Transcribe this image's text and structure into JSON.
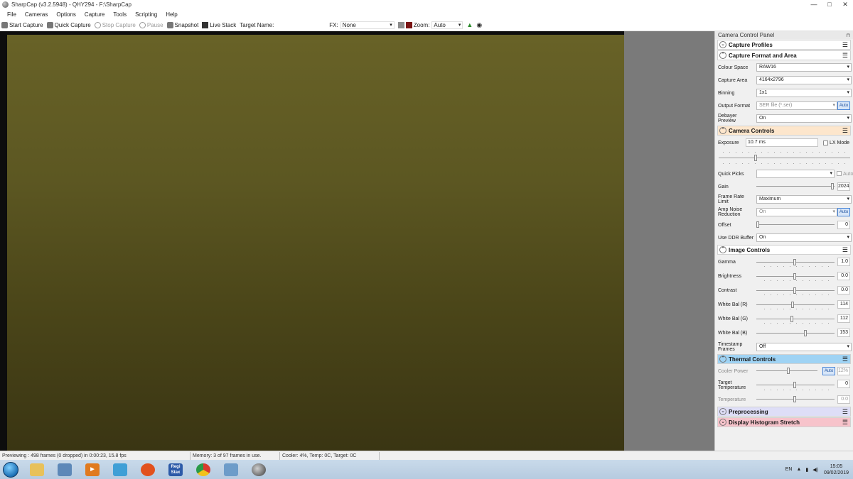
{
  "window": {
    "title": "SharpCap (v3.2.5948) - QHY294 - F:\\SharpCap",
    "buttons": {
      "minimize": "—",
      "maximize": "□",
      "close": "✕"
    }
  },
  "menu": [
    "File",
    "Cameras",
    "Options",
    "Capture",
    "Tools",
    "Scripting",
    "Help"
  ],
  "toolbar": {
    "start_capture": "Start Capture",
    "quick_capture": "Quick Capture",
    "stop_capture": "Stop Capture",
    "pause": "Pause",
    "snapshot": "Snapshot",
    "live_stack": "Live Stack",
    "target_name_label": "Target Name:",
    "fx_label": "FX:",
    "fx_value": "None",
    "zoom_label": "Zoom:",
    "zoom_value": "Auto"
  },
  "panel": {
    "title": "Camera Control Panel",
    "sections": {
      "capture_profiles": "Capture Profiles",
      "capture_format": "Capture Format and Area",
      "camera_controls": "Camera Controls",
      "image_controls": "Image Controls",
      "thermal_controls": "Thermal Controls",
      "preprocessing": "Preprocessing",
      "display_histogram": "Display Histogram Stretch"
    },
    "format": {
      "colour_space_label": "Colour Space",
      "colour_space_value": "RAW16",
      "capture_area_label": "Capture Area",
      "capture_area_value": "4164x2796",
      "binning_label": "Binning",
      "binning_value": "1x1",
      "output_format_label": "Output Format",
      "output_format_value": "SER file (*.ser)",
      "output_auto": "Auto",
      "debayer_label": "Debayer Preview",
      "debayer_value": "On"
    },
    "camera": {
      "exposure_label": "Exposure",
      "exposure_value": "10.7 ms",
      "lx_mode": "LX Mode",
      "quick_picks_label": "Quick Picks",
      "quick_picks_auto": "Auto",
      "gain_label": "Gain",
      "gain_value": "2024",
      "frame_rate_label": "Frame Rate Limit",
      "frame_rate_value": "Maximum",
      "amp_noise_label": "Amp Noise Reduction",
      "amp_noise_value": "On",
      "amp_noise_auto": "Auto",
      "offset_label": "Offset",
      "offset_value": "0",
      "ddr_label": "Use DDR Buffer",
      "ddr_value": "On"
    },
    "image": {
      "gamma_label": "Gamma",
      "gamma_value": "1.0",
      "brightness_label": "Brightness",
      "brightness_value": "0.0",
      "contrast_label": "Contrast",
      "contrast_value": "0.0",
      "wb_r_label": "White Bal (R)",
      "wb_r_value": "114",
      "wb_g_label": "White Bal (G)",
      "wb_g_value": "112",
      "wb_b_label": "White Bal (B)",
      "wb_b_value": "153",
      "timestamp_label": "Timestamp Frames",
      "timestamp_value": "Off"
    },
    "thermal": {
      "cooler_power_label": "Cooler Power",
      "cooler_auto": "Auto",
      "cooler_power_value": "12%",
      "target_temp_label": "Target Temperature",
      "target_temp_value": "0",
      "temperature_label": "Temperature",
      "temperature_value": "0.0"
    }
  },
  "status": {
    "previewing": "Previewing : 498 frames (0 dropped) in 0:00:23, 15.8 fps",
    "memory": "Memory: 3 of 97 frames in use.",
    "cooler": "Cooler: 4%, Temp: 0C, Target: 0C"
  },
  "taskbar": {
    "apps": [
      "file-explorer",
      "image-viewer",
      "media-player",
      "notepad",
      "firefox",
      "registax",
      "chrome",
      "computer",
      "sharpcap"
    ],
    "registax_label": "Regi Stax",
    "clock_time": "15:05",
    "clock_date": "09/02/2019",
    "tray_lang": "EN"
  }
}
